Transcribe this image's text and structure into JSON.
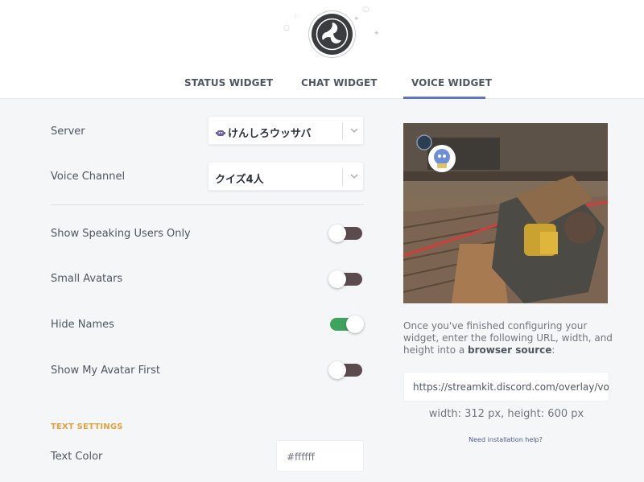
{
  "colors": {
    "accent": "#5f74c6",
    "toggle_on": "#3ca45c",
    "toggle_off": "#5b4a4e",
    "section_title": "#e3a23a"
  },
  "tabs": [
    {
      "label": "STATUS WIDGET",
      "active": false
    },
    {
      "label": "CHAT WIDGET",
      "active": false
    },
    {
      "label": "VOICE WIDGET",
      "active": true
    }
  ],
  "settings": {
    "server": {
      "label": "Server",
      "value": "けんしろウッサバ",
      "icon": "server-emoji-icon"
    },
    "voice_channel": {
      "label": "Voice Channel",
      "value": "クイズ4人"
    },
    "toggles": [
      {
        "label": "Show Speaking Users Only",
        "on": false
      },
      {
        "label": "Small Avatars",
        "on": false
      },
      {
        "label": "Hide Names",
        "on": true
      },
      {
        "label": "Show My Avatar First",
        "on": false
      }
    ],
    "text_settings": {
      "title": "TEXT SETTINGS",
      "text_color_label": "Text Color",
      "text_color_value": "#ffffff"
    }
  },
  "preview": {
    "info_pre": "Once you've finished configuring your widget, enter the following URL, width, and height into a ",
    "info_bold": "browser source",
    "info_post": ":",
    "url": "https://streamkit.discord.com/overlay/voice",
    "width_label": "width:",
    "width_value": "312",
    "height_label": "height:",
    "height_value": "600",
    "unit": "px",
    "help_link": "Need installation help?"
  }
}
